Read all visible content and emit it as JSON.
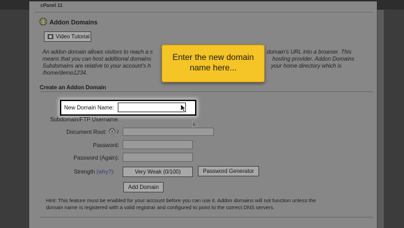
{
  "header": {
    "tab_label": "cPanel 11"
  },
  "page": {
    "title": "Addon Domains",
    "video_button": "Video Tutorial"
  },
  "description": "An addon domain allows visitors to reach a s... domain's URL into a browser. This means that you can host additional domains ... hosting provider. Addon Domains Subdomains are relative to your account's h... your home directory which is /home/demo1234.",
  "description_lines": [
    "An addon domain allows visitors to reach a s",
    "means that you can host additional domains",
    "Subdomains are relative to your account's h",
    "/home/demo1234."
  ],
  "description_lines_right": [
    "domain's URL into a browser. This",
    "hosting provider. Addon Domains",
    "your home directory which is"
  ],
  "section_title": "Create an Addon Domain",
  "form": {
    "new_domain_label": "New Domain Name:",
    "subdomain_label": "Subdomain/FTP Username:",
    "docroot_label": "Document Root:",
    "docroot_prefix": "/",
    "password_label": "Password:",
    "password_again_label": "Password (Again):",
    "strength_label": "Strength",
    "why_link": "(why?):",
    "strength_value": "Very Weak (0/100)",
    "password_generator": "Password Generator",
    "submit": "Add Domain"
  },
  "callout": {
    "line1": "Enter the new domain",
    "line2": "name here..."
  },
  "hint": {
    "line1": "Hint: This feature must be enabled for your account before you can use it. Addon domains will not function unless the",
    "line2": "domain name is registered with a valid registrar and configured to point to the correct DNS servers."
  },
  "colors": {
    "callout": "#f5c426",
    "page_dimmed": "#878787",
    "highlight": "#ffffff"
  }
}
